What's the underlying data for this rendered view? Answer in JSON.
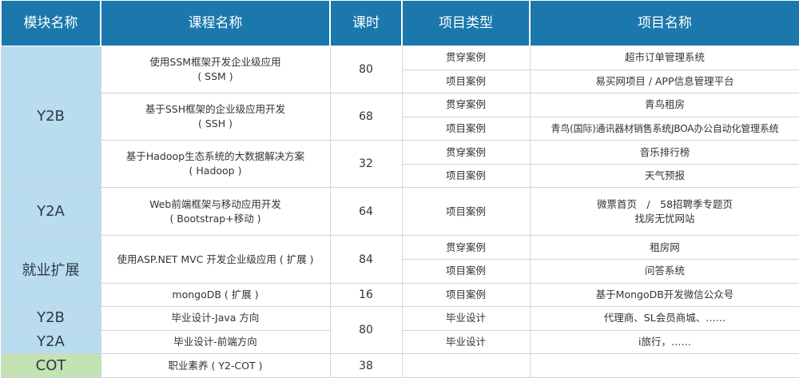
{
  "headers": {
    "module": "模块名称",
    "course": "课程名称",
    "hours": "课时",
    "ptype": "项目类型",
    "pname": "项目名称"
  },
  "rows": {
    "y2b": {
      "module": "Y2B",
      "c1": {
        "title": "使用SSM框架开发企业级应用",
        "sub": "( SSM )",
        "hours": "80",
        "p1": {
          "type": "贯穿案例",
          "name": "超市订单管理系统"
        },
        "p2": {
          "type": "项目案例",
          "name": "易买网项目 / APP信息管理平台"
        }
      },
      "c2": {
        "title": "基于SSH框架的企业级应用开发",
        "sub": "( SSH )",
        "hours": "68",
        "p1": {
          "type": "贯穿案例",
          "name": "青鸟租房"
        },
        "p2": {
          "type": "项目案例",
          "name": "青鸟(国际)通讯器材销售系统JBOA办公自动化管理系统"
        }
      },
      "c3": {
        "title": "基于Hadoop生态系统的大数据解决方案",
        "sub": "( Hadoop )",
        "hours": "32",
        "p1": {
          "type": "贯穿案例",
          "name": "音乐排行榜"
        },
        "p2": {
          "type": "项目案例",
          "name": "天气预报"
        }
      }
    },
    "y2a": {
      "module": "Y2A",
      "c1": {
        "title": "Web前端框架与移动应用开发",
        "sub": "( Bootstrap+移动 )",
        "hours": "64",
        "p1": {
          "type": "项目案例",
          "name1": "微票首页　/　58招聘季专题页",
          "name2": "找房无忧网站"
        }
      }
    },
    "jiuye": {
      "module": "就业扩展",
      "c1": {
        "title": "使用ASP.NET MVC 开发企业级应用 ( 扩展 )",
        "hours": "84",
        "p1": {
          "type": "贯穿案例",
          "name": "租房网"
        },
        "p2": {
          "type": "项目案例",
          "name": "问答系统"
        }
      },
      "c2": {
        "title": "mongoDB ( 扩展 )",
        "hours": "16",
        "p1": {
          "type": "项目案例",
          "name": "基于MongoDB开发微信公众号"
        }
      }
    },
    "design": {
      "hours": "80",
      "r1": {
        "module": "Y2B",
        "course": "毕业设计-Java 方向",
        "type": "毕业设计",
        "name": "代理商、SL会员商城、……"
      },
      "r2": {
        "module": "Y2A",
        "course": "毕业设计-前端方向",
        "type": "毕业设计",
        "name": "i旅行，……"
      }
    },
    "cot": {
      "module": "COT",
      "course": "职业素养 ( Y2-COT )",
      "hours": "38"
    }
  },
  "colors": {
    "header": "#1b78ad",
    "module": "#b9dcef",
    "cot": "#c5e2b2",
    "border": "#c9d6df"
  }
}
